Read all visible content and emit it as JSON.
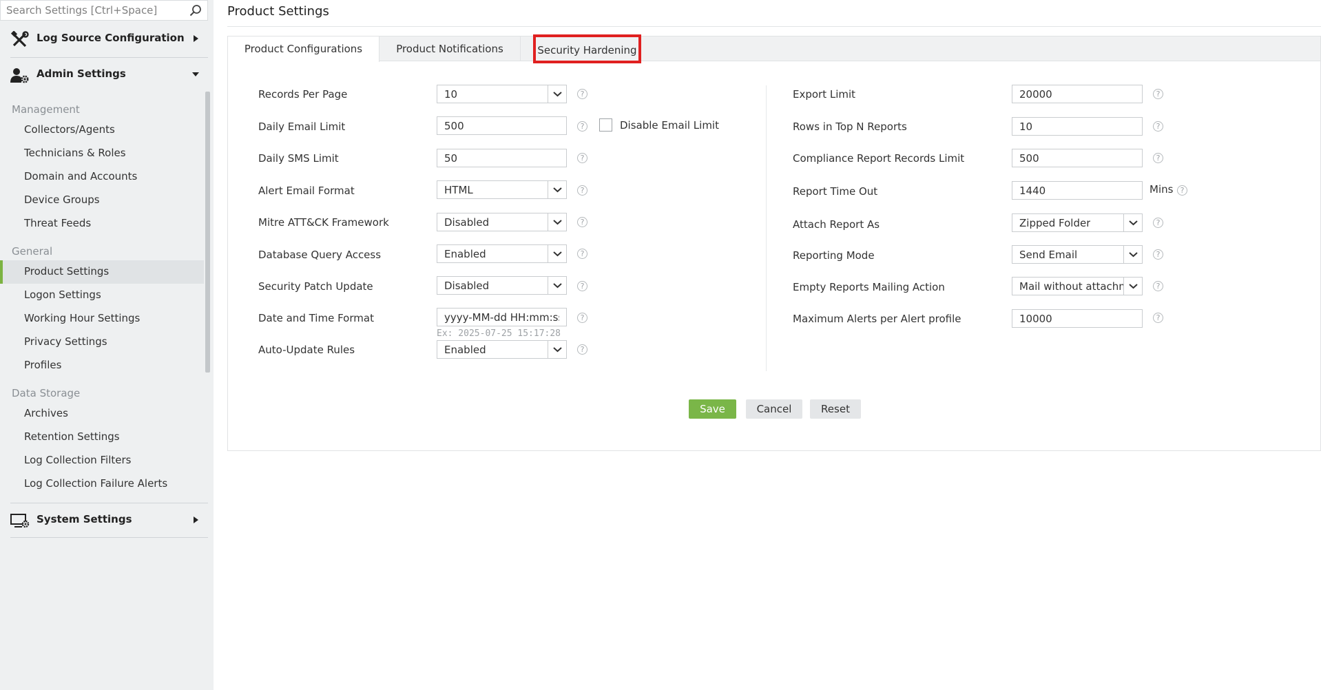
{
  "search": {
    "placeholder": "Search Settings [Ctrl+Space]"
  },
  "sidebar": {
    "sections": [
      {
        "label": "Log Source Configuration",
        "icon": "tools-icon",
        "expanded": false
      },
      {
        "label": "Admin Settings",
        "icon": "user-gear-icon",
        "expanded": true
      },
      {
        "label": "System Settings",
        "icon": "monitor-gear-icon",
        "expanded": false
      }
    ],
    "groups": [
      {
        "title": "Management",
        "items": [
          "Collectors/Agents",
          "Technicians & Roles",
          "Domain and Accounts",
          "Device Groups",
          "Threat Feeds"
        ]
      },
      {
        "title": "General",
        "items": [
          "Product Settings",
          "Logon Settings",
          "Working Hour Settings",
          "Privacy Settings",
          "Profiles"
        ]
      },
      {
        "title": "Data Storage",
        "items": [
          "Archives",
          "Retention Settings",
          "Log Collection Filters",
          "Log Collection Failure Alerts"
        ]
      }
    ],
    "active_item": "Product Settings",
    "accent_color": "#7cb342"
  },
  "page": {
    "title": "Product Settings"
  },
  "tabs": [
    {
      "label": "Product Configurations",
      "active": true
    },
    {
      "label": "Product Notifications",
      "active": false
    },
    {
      "label": "Security Hardening",
      "active": false,
      "highlighted": true
    }
  ],
  "left_fields": {
    "records_per_page": {
      "label": "Records Per Page",
      "value": "10"
    },
    "daily_email_limit": {
      "label": "Daily Email Limit",
      "value": "500",
      "checkbox_label": "Disable Email Limit",
      "checked": false
    },
    "daily_sms_limit": {
      "label": "Daily SMS Limit",
      "value": "50"
    },
    "alert_email_format": {
      "label": "Alert Email Format",
      "value": "HTML"
    },
    "mitre": {
      "label": "Mitre ATT&CK Framework",
      "value": "Disabled"
    },
    "db_query": {
      "label": "Database Query Access",
      "value": "Enabled"
    },
    "security_patch": {
      "label": "Security Patch Update",
      "value": "Disabled"
    },
    "date_time_format": {
      "label": "Date and Time Format",
      "value": "yyyy-MM-dd HH:mm:ss",
      "example": "Ex: 2025-07-25 15:17:28"
    },
    "auto_update": {
      "label": "Auto-Update Rules",
      "value": "Enabled"
    }
  },
  "right_fields": {
    "export_limit": {
      "label": "Export Limit",
      "value": "20000"
    },
    "rows_top_n": {
      "label": "Rows in Top N Reports",
      "value": "10"
    },
    "compliance_limit": {
      "label": "Compliance Report Records Limit",
      "value": "500"
    },
    "report_timeout": {
      "label": "Report Time Out",
      "value": "1440",
      "unit": "Mins"
    },
    "attach_report": {
      "label": "Attach Report As",
      "value": "Zipped Folder"
    },
    "reporting_mode": {
      "label": "Reporting Mode",
      "value": "Send Email"
    },
    "empty_reports": {
      "label": "Empty Reports Mailing Action",
      "value": "Mail without attachm"
    },
    "max_alerts": {
      "label": "Maximum Alerts per Alert profile",
      "value": "10000"
    }
  },
  "help_glyph": "?",
  "buttons": {
    "save": "Save",
    "cancel": "Cancel",
    "reset": "Reset"
  },
  "colors": {
    "save_button": "#7ab648",
    "highlight_border": "#e02020"
  }
}
